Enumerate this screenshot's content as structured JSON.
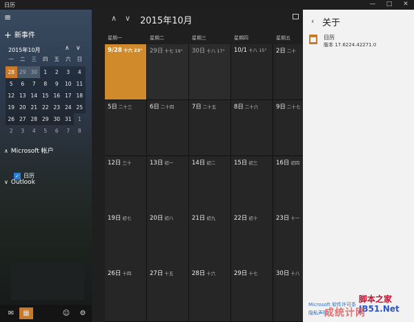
{
  "window": {
    "title": "日历",
    "min": "—",
    "max": "□",
    "close": "✕"
  },
  "sidebar": {
    "menu_icon": "≡",
    "new_event": "新事件",
    "mini_month": "2015年10月",
    "mini_up": "∧",
    "mini_down": "∨",
    "mini_weekdays": [
      "一",
      "二",
      "三",
      "四",
      "五",
      "六",
      "日"
    ],
    "mini_rows": [
      [
        "28",
        "29",
        "30",
        "1",
        "2",
        "3",
        "4"
      ],
      [
        "5",
        "6",
        "7",
        "8",
        "9",
        "10",
        "11"
      ],
      [
        "12",
        "13",
        "14",
        "15",
        "16",
        "17",
        "18"
      ],
      [
        "19",
        "20",
        "21",
        "22",
        "23",
        "24",
        "25"
      ],
      [
        "26",
        "27",
        "28",
        "29",
        "30",
        "31",
        "1"
      ],
      [
        "2",
        "3",
        "4",
        "5",
        "6",
        "7",
        "8"
      ]
    ],
    "account_section": "Microsoft 帐户",
    "calendar_item": "日历",
    "outlook_section": "Outlook",
    "chev_open": "∧",
    "chev_closed": "∨",
    "check": "✓"
  },
  "bottombar": {
    "mail_icon": "✉",
    "calendar_icon": "▦",
    "smile_icon": "☺",
    "settings_icon": "⚙"
  },
  "main": {
    "up": "∧",
    "down": "∨",
    "month_title": "2015年10月",
    "weekdays": [
      "星期一",
      "星期二",
      "星期三",
      "星期四",
      "星期五"
    ],
    "rows": [
      [
        {
          "d": "9/28",
          "l": "十六 23°"
        },
        {
          "d": "29日",
          "l": "十七 19°"
        },
        {
          "d": "30日",
          "l": "十八 17°"
        },
        {
          "d": "10/1",
          "l": "十八 15°"
        },
        {
          "d": "2日",
          "l": "二十"
        }
      ],
      [
        {
          "d": "5日",
          "l": "二十三"
        },
        {
          "d": "6日",
          "l": "二十四"
        },
        {
          "d": "7日",
          "l": "二十五"
        },
        {
          "d": "8日",
          "l": "二十六"
        },
        {
          "d": "9日",
          "l": "二十七"
        }
      ],
      [
        {
          "d": "12日",
          "l": "三十"
        },
        {
          "d": "13日",
          "l": "初一"
        },
        {
          "d": "14日",
          "l": "初二"
        },
        {
          "d": "15日",
          "l": "初三"
        },
        {
          "d": "16日",
          "l": "初四"
        }
      ],
      [
        {
          "d": "19日",
          "l": "初七"
        },
        {
          "d": "20日",
          "l": "初八"
        },
        {
          "d": "21日",
          "l": "初九"
        },
        {
          "d": "22日",
          "l": "初十"
        },
        {
          "d": "23日",
          "l": "十一"
        }
      ],
      [
        {
          "d": "26日",
          "l": "十四"
        },
        {
          "d": "27日",
          "l": "十五"
        },
        {
          "d": "28日",
          "l": "十六"
        },
        {
          "d": "29日",
          "l": "十七"
        },
        {
          "d": "30日",
          "l": "十八"
        }
      ]
    ]
  },
  "about": {
    "back": "‹",
    "title": "关于",
    "app_name": "日历",
    "version": "版本 17.6224.42271.0",
    "license": "Microsoft 软件许可条",
    "privacy": "隐私声明"
  },
  "watermark": {
    "line1": "脚本之家",
    "line2": "JB51.Net",
    "line3": "成统计网"
  }
}
